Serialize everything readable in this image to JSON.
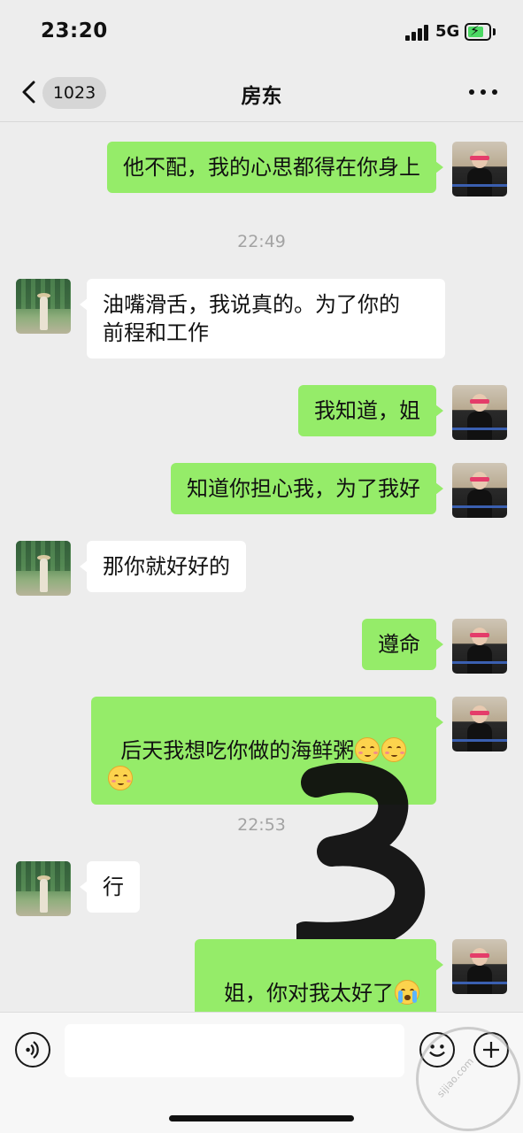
{
  "status_bar": {
    "time": "23:20",
    "network": "5G",
    "battery_charging": true
  },
  "nav": {
    "unread_count": "1023",
    "title": "房东",
    "back_icon": "chevron-left-icon",
    "more_icon": "more-dots-icon"
  },
  "colors": {
    "outgoing_bubble": "#95ec69",
    "incoming_bubble": "#ffffff",
    "background": "#ededed",
    "timestamp": "#a3a3a3"
  },
  "messages": [
    {
      "sender": "self",
      "text": "他不配，我的心思都得在你身上"
    },
    {
      "type": "timestamp",
      "text": "22:49"
    },
    {
      "sender": "other",
      "text": "油嘴滑舌，我说真的。为了你的\n前程和工作"
    },
    {
      "sender": "self",
      "text": "我知道，姐"
    },
    {
      "sender": "self",
      "text": "知道你担心我，为了我好"
    },
    {
      "sender": "other",
      "text": "那你就好好的"
    },
    {
      "sender": "self",
      "text": "遵命"
    },
    {
      "sender": "self",
      "text": "后天我想吃你做的海鲜粥",
      "emojis": [
        "smiling-blush-emoji",
        "smiling-blush-emoji",
        "smiling-blush-emoji"
      ]
    },
    {
      "type": "timestamp",
      "text": "22:53"
    },
    {
      "sender": "other",
      "text": "行"
    },
    {
      "sender": "self",
      "text": "姐，你对我太好了",
      "emojis": [
        "loudly-crying-emoji"
      ]
    }
  ],
  "input_bar": {
    "voice_icon": "voice-icon",
    "emoji_icon": "emoji-icon",
    "plus_icon": "plus-icon",
    "input_value": ""
  },
  "watermark": {
    "text": "sijiao.com"
  }
}
